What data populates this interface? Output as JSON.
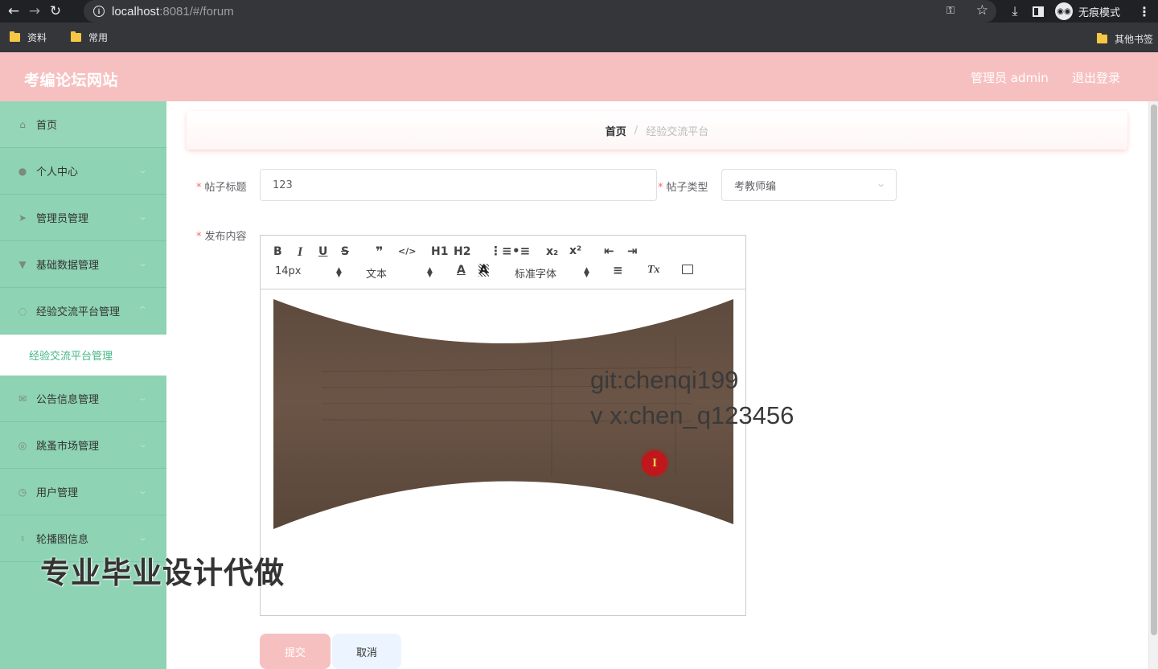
{
  "browser": {
    "url_host": "localhost",
    "url_rest": ":8081/#/forum",
    "incognito_label": "无痕模式",
    "bookmarks": [
      "资料",
      "常用"
    ],
    "bookmarks_right": "其他书签"
  },
  "header": {
    "site_title": "考编论坛网站",
    "admin_label": "管理员 admin",
    "logout_label": "退出登录"
  },
  "sidebar": {
    "items": [
      {
        "label": "首页",
        "icon": "home-icon"
      },
      {
        "label": "个人中心",
        "icon": "user-icon"
      },
      {
        "label": "管理员管理",
        "icon": "send-icon"
      },
      {
        "label": "基础数据管理",
        "icon": "data-icon"
      },
      {
        "label": "经验交流平台管理",
        "icon": "loading-icon"
      },
      {
        "label": "公告信息管理",
        "icon": "message-icon"
      },
      {
        "label": "跳蚤市场管理",
        "icon": "compass-icon"
      },
      {
        "label": "用户管理",
        "icon": "clock-icon"
      },
      {
        "label": "轮播图信息",
        "icon": "microphone-icon"
      }
    ],
    "active_subitem": "经验交流平台管理"
  },
  "breadcrumb": {
    "home": "首页",
    "separator": "/",
    "current": "经验交流平台"
  },
  "form": {
    "title_label": "帖子标题",
    "title_value": "123",
    "type_label": "帖子类型",
    "type_value": "考教师编",
    "content_label": "发布内容",
    "required_mark": "*",
    "submit_label": "提交",
    "cancel_label": "取消"
  },
  "editor": {
    "toolbar": {
      "bold": "B",
      "italic": "I",
      "underline": "U",
      "strike": "S",
      "quote": "❞",
      "code": "</>",
      "h1": "H1",
      "h2": "H2",
      "subscript": "x₂",
      "superscript": "x²",
      "font_size": "14px",
      "header": "文本",
      "font_family": "标准字体",
      "clean": "Tx"
    },
    "watermark_lines": [
      "git:chenqi199",
      "v x:chen_q123456"
    ]
  },
  "overlay_text": "专业毕业设计代做",
  "colors": {
    "header_bg": "#f7c0c0",
    "sidebar_bg": "#8ed3b3",
    "active_text": "#41b883",
    "required": "#f56c6c"
  }
}
